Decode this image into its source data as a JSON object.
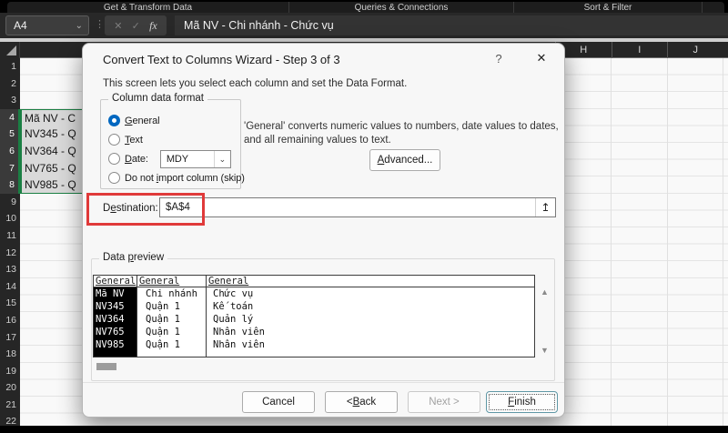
{
  "icons": {
    "chevron_down": "⌄",
    "dots": "⋮",
    "cancel_x": "✕",
    "check": "✓",
    "fx": "fx",
    "help": "?",
    "close": "✕",
    "collapse_up": "↥",
    "scroll_up": "▲",
    "scroll_down": "▼"
  },
  "ribbon": {
    "groups": [
      "Get & Transform Data",
      "Queries & Connections",
      "Sort & Filter"
    ]
  },
  "formula_bar": {
    "name_box": "A4",
    "formula": "Mã NV - Chi nhánh - Chức vụ"
  },
  "sheet": {
    "column_headers": [
      "H",
      "I",
      "J"
    ],
    "row_count": 22,
    "selected_rows": [
      4,
      8
    ],
    "cells": [
      {
        "row": 4,
        "text": "Mã NV - C"
      },
      {
        "row": 5,
        "text": "NV345 - Q"
      },
      {
        "row": 6,
        "text": "NV364 - Q"
      },
      {
        "row": 7,
        "text": "NV765 - Q"
      },
      {
        "row": 8,
        "text": "NV985 - Q"
      }
    ]
  },
  "dialog": {
    "title": "Convert Text to Columns Wizard - Step 3 of 3",
    "subtitle": "This screen lets you select each column and set the Data Format.",
    "format_group": {
      "label": "Column data format",
      "options": [
        {
          "text": "General",
          "accel": 0,
          "selected": true
        },
        {
          "text": "Text",
          "accel": 0,
          "selected": false
        },
        {
          "text": "Date:",
          "accel": 0,
          "selected": false,
          "dropdown": "MDY"
        },
        {
          "text": "Do not import column (skip)",
          "accel": 7,
          "selected": false
        }
      ]
    },
    "general_note": "'General' converts numeric values to numbers, date values to dates, and all remaining values to text.",
    "advanced_button": {
      "text": "Advanced...",
      "accel": 0
    },
    "destination": {
      "label": {
        "text": "Destination:",
        "accel": 1
      },
      "value": "$A$4"
    },
    "data_preview": {
      "label": {
        "text": "Data preview",
        "accel": 5
      },
      "headers": [
        "General",
        "General",
        "General"
      ],
      "rows": [
        [
          "Mã NV",
          "Chi nhánh",
          "Chức vụ"
        ],
        [
          "NV345",
          "Quận 1",
          "Kế toán"
        ],
        [
          "NV364",
          "Quận 1",
          "Quản lý"
        ],
        [
          "NV765",
          "Quận 1",
          "Nhân viên"
        ],
        [
          "NV985",
          "Quận 1",
          "Nhân viên"
        ]
      ]
    },
    "buttons": [
      {
        "name": "cancel",
        "text": "Cancel",
        "accel": -1,
        "disabled": false,
        "default": false
      },
      {
        "name": "back",
        "text": "< Back",
        "accel": 2,
        "disabled": false,
        "default": false
      },
      {
        "name": "next",
        "text": "Next >",
        "accel": -1,
        "disabled": true,
        "default": false
      },
      {
        "name": "finish",
        "text": "Finish",
        "accel": 0,
        "disabled": false,
        "default": true
      }
    ]
  },
  "colors": {
    "accent_blue": "#0067c0",
    "annotation_red": "#e03a3a",
    "selection_green": "#1a7f43"
  }
}
